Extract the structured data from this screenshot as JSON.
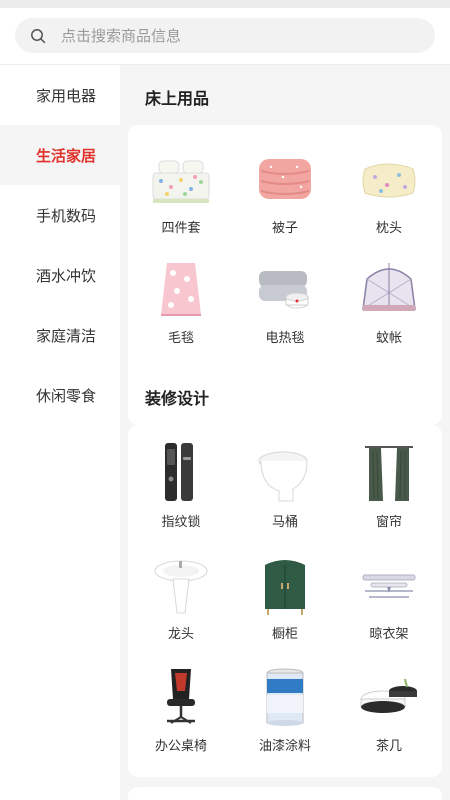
{
  "search": {
    "placeholder": "点击搜索商品信息"
  },
  "sidebar": {
    "items": [
      {
        "label": "家用电器"
      },
      {
        "label": "生活家居"
      },
      {
        "label": "手机数码"
      },
      {
        "label": "酒水冲饮"
      },
      {
        "label": "家庭清洁"
      },
      {
        "label": "休闲零食"
      }
    ],
    "active_index": 1
  },
  "main": {
    "sections": [
      {
        "title": "床上用品",
        "items": [
          {
            "label": "四件套",
            "icon": "bedding-set-icon"
          },
          {
            "label": "被子",
            "icon": "quilt-icon"
          },
          {
            "label": "枕头",
            "icon": "pillow-icon"
          },
          {
            "label": "毛毯",
            "icon": "blanket-icon"
          },
          {
            "label": "电热毯",
            "icon": "electric-blanket-icon"
          },
          {
            "label": "蚊帐",
            "icon": "mosquito-net-icon"
          }
        ]
      },
      {
        "title": "装修设计",
        "items": [
          {
            "label": "指纹锁",
            "icon": "fingerprint-lock-icon"
          },
          {
            "label": "马桶",
            "icon": "toilet-icon"
          },
          {
            "label": "窗帘",
            "icon": "curtain-icon"
          },
          {
            "label": "龙头",
            "icon": "faucet-sink-icon"
          },
          {
            "label": "橱柜",
            "icon": "cabinet-icon"
          },
          {
            "label": "晾衣架",
            "icon": "drying-rack-icon"
          },
          {
            "label": "办公桌椅",
            "icon": "office-chair-icon"
          },
          {
            "label": "油漆涂料",
            "icon": "paint-bucket-icon"
          },
          {
            "label": "茶几",
            "icon": "coffee-table-icon"
          }
        ]
      }
    ]
  },
  "colors": {
    "accent": "#e0312a",
    "sidebar_active_bg": "#f5f5f5",
    "main_bg": "#f5f5f5"
  }
}
